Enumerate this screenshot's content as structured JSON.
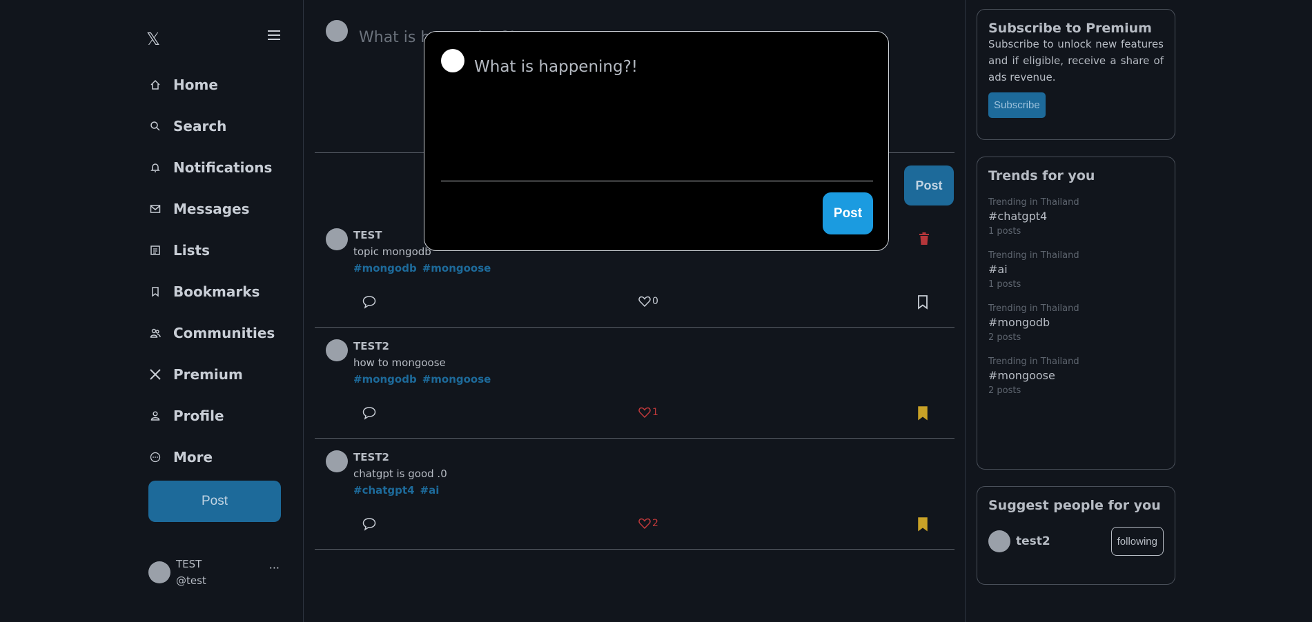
{
  "sidebar": {
    "logo": "𝕏",
    "items": [
      {
        "label": "Home",
        "icon": "home-icon"
      },
      {
        "label": "Search",
        "icon": "search-icon"
      },
      {
        "label": "Notifications",
        "icon": "bell-icon"
      },
      {
        "label": "Messages",
        "icon": "mail-icon"
      },
      {
        "label": "Lists",
        "icon": "list-icon"
      },
      {
        "label": "Bookmarks",
        "icon": "bookmark-icon"
      },
      {
        "label": "Communities",
        "icon": "users-icon"
      },
      {
        "label": "Premium",
        "icon": "x-icon"
      },
      {
        "label": "Profile",
        "icon": "person-icon"
      },
      {
        "label": "More",
        "icon": "more-circle-icon"
      }
    ],
    "post_label": "Post",
    "user": {
      "name": "TEST",
      "handle": "@test",
      "more": "···"
    }
  },
  "compose": {
    "placeholder": "What is happening?!",
    "post_label": "Post"
  },
  "posts": [
    {
      "author": "TEST",
      "content": "topic mongodb",
      "tags": [
        "#mongodb",
        "#mongoose"
      ],
      "likes": "0",
      "liked": false,
      "bookmarked": false,
      "deletable": true
    },
    {
      "author": "TEST2",
      "content": "how to mongoose",
      "tags": [
        "#mongodb",
        "#mongoose"
      ],
      "likes": "1",
      "liked": true,
      "bookmarked": true,
      "deletable": false
    },
    {
      "author": "TEST2",
      "content": "chatgpt is good .0",
      "tags": [
        "#chatgpt4",
        "#ai"
      ],
      "likes": "2",
      "liked": true,
      "bookmarked": true,
      "deletable": false
    }
  ],
  "premium": {
    "title": "Subscribe to Premium",
    "text": "Subscribe to unlock new features and if eligible, receive a share of ads revenue.",
    "button": "Subscribe"
  },
  "trends": {
    "title": "Trends for you",
    "items": [
      {
        "label": "Trending in Thailand",
        "tag": "#chatgpt4",
        "count": "1 posts"
      },
      {
        "label": "Trending in Thailand",
        "tag": "#ai",
        "count": "1 posts"
      },
      {
        "label": "Trending in Thailand",
        "tag": "#mongodb",
        "count": "2 posts"
      },
      {
        "label": "Trending in Thailand",
        "tag": "#mongoose",
        "count": "2 posts"
      }
    ]
  },
  "suggest": {
    "title": "Suggest people for you",
    "people": [
      {
        "name": "test2",
        "button": "following"
      }
    ]
  },
  "modal": {
    "placeholder": "What is happening?!",
    "post_label": "Post"
  },
  "colors": {
    "accent": "#1d6a9a",
    "modal_post": "#1b9be0",
    "like": "#c0393b",
    "bookmark": "#c9a227",
    "tag": "#1d6a9a"
  }
}
